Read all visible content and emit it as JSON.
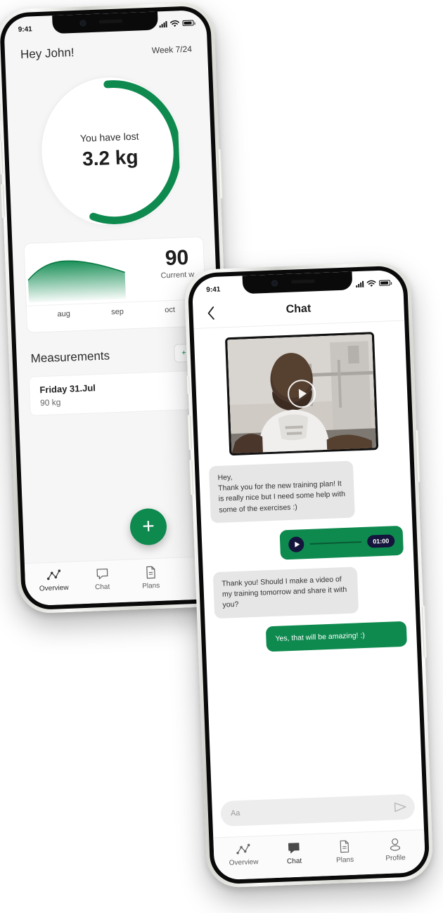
{
  "meta": {
    "accent_green": "#0e8a4f",
    "bubble_in_bg": "#e6e6e6",
    "screen_bg": "#f6f6f6"
  },
  "phone_overview": {
    "status": {
      "time": "9:41",
      "signal_icon": "signal-bars-icon",
      "wifi_icon": "wifi-icon",
      "battery_icon": "battery-icon"
    },
    "header": {
      "greeting": "Hey John!",
      "week": "Week 7/24"
    },
    "progress_ring": {
      "label": "You have lost",
      "value": "3.2 kg",
      "percent": 62,
      "color": "#0e8a4f"
    },
    "weight_card": {
      "current_value": "90",
      "current_label": "Current w",
      "months": [
        "aug",
        "sep",
        "oct"
      ]
    },
    "measurements": {
      "title": "Measurements",
      "add_label": "+ Ad",
      "rows": [
        {
          "date": "Friday 31.Jul",
          "value": "90 kg"
        }
      ],
      "fab_label": "+"
    },
    "tabs": [
      {
        "label": "Overview",
        "icon": "overview-chart-icon",
        "active": true
      },
      {
        "label": "Chat",
        "icon": "chat-bubble-icon",
        "active": false
      },
      {
        "label": "Plans",
        "icon": "document-icon",
        "active": false
      }
    ]
  },
  "phone_chat": {
    "status": {
      "time": "9:41",
      "signal_icon": "signal-bars-icon",
      "wifi_icon": "wifi-icon",
      "battery_icon": "battery-icon"
    },
    "header": {
      "title": "Chat",
      "back_icon": "chevron-left-icon"
    },
    "messages": [
      {
        "type": "video",
        "side": "in",
        "alt": "training video thumbnail",
        "play_icon": "play-icon"
      },
      {
        "type": "text",
        "side": "in",
        "text": "Hey,\nThank you for the new training plan! It is really nice but I need some help with some of the exercises :)"
      },
      {
        "type": "audio",
        "side": "out",
        "duration": "01:00",
        "play_icon": "play-icon"
      },
      {
        "type": "text",
        "side": "in",
        "text": "Thank you! Should I make a video of my training tomorrow and share it with you?"
      },
      {
        "type": "text",
        "side": "out",
        "text": "Yes, that will be amazing! :)"
      }
    ],
    "composer": {
      "placeholder": "Aa",
      "value": "",
      "send_icon": "send-arrow-icon"
    },
    "tabs": [
      {
        "label": "Overview",
        "icon": "overview-chart-icon",
        "active": false
      },
      {
        "label": "Chat",
        "icon": "chat-bubble-filled-icon",
        "active": true
      },
      {
        "label": "Plans",
        "icon": "document-icon",
        "active": false
      },
      {
        "label": "Profile",
        "icon": "person-icon",
        "active": false
      }
    ]
  },
  "chart_data": {
    "type": "area",
    "title": "",
    "categories": [
      "aug",
      "sep",
      "oct"
    ],
    "x": [
      0,
      1,
      2,
      3,
      4,
      5,
      6,
      7,
      8
    ],
    "values": [
      92.4,
      93.2,
      93.4,
      93.1,
      92.5,
      91.8,
      91.2,
      90.6,
      90.0
    ],
    "xlabel": "",
    "ylabel": "",
    "ylim": [
      89,
      94
    ],
    "grid": false,
    "legend": "none",
    "annotation_value": "90",
    "annotation_label": "Current w",
    "fill_color": "#0e8a4f",
    "line_color": "#0a7a44"
  }
}
